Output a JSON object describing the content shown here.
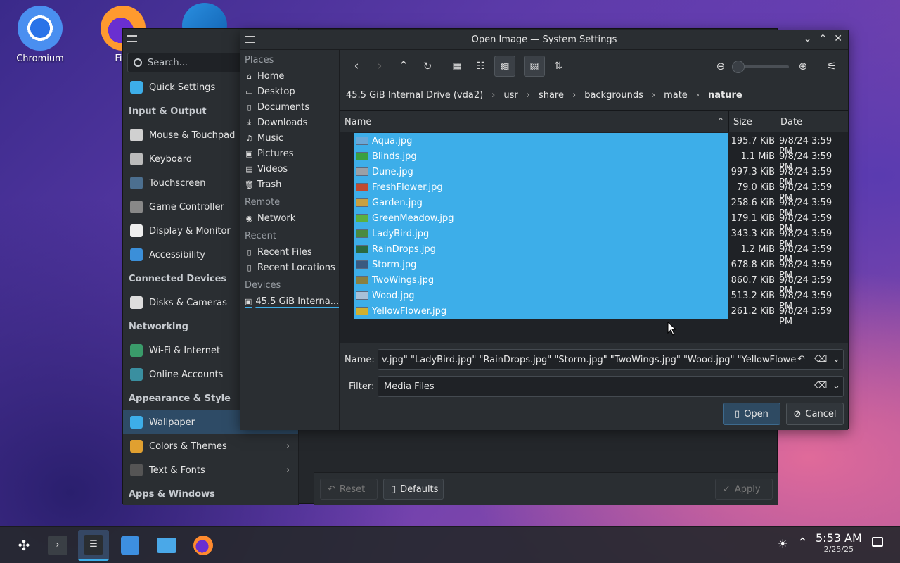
{
  "desktop": {
    "icons": [
      {
        "label": "Chromium",
        "icon": "chromium-icon"
      },
      {
        "label": "Fire",
        "icon": "firefox-icon"
      },
      {
        "label": "",
        "icon": "vscode-icon"
      }
    ]
  },
  "settings": {
    "search_placeholder": "Search...",
    "sidebar": [
      {
        "type": "item",
        "label": "Quick Settings",
        "icon": "quick-settings-icon",
        "color": "#3daee9"
      },
      {
        "type": "section",
        "label": "Input & Output"
      },
      {
        "type": "item",
        "label": "Mouse & Touchpad",
        "icon": "mouse-icon",
        "color": "#d0d0d0"
      },
      {
        "type": "item",
        "label": "Keyboard",
        "icon": "keyboard-icon",
        "color": "#bbbbbb"
      },
      {
        "type": "item",
        "label": "Touchscreen",
        "icon": "touchscreen-icon",
        "color": "#4c6f8f"
      },
      {
        "type": "item",
        "label": "Game Controller",
        "icon": "gamepad-icon",
        "color": "#888888"
      },
      {
        "type": "item",
        "label": "Display & Monitor",
        "icon": "display-icon",
        "color": "#eeeeee"
      },
      {
        "type": "item",
        "label": "Accessibility",
        "icon": "accessibility-icon",
        "color": "#3b8fd9"
      },
      {
        "type": "section",
        "label": "Connected Devices"
      },
      {
        "type": "item",
        "label": "Disks & Cameras",
        "icon": "disks-icon",
        "color": "#dddddd"
      },
      {
        "type": "section",
        "label": "Networking"
      },
      {
        "type": "item",
        "label": "Wi-Fi & Internet",
        "icon": "globe-icon",
        "color": "#3a9b6a"
      },
      {
        "type": "item",
        "label": "Online Accounts",
        "icon": "online-accounts-icon",
        "color": "#3a8fa0"
      },
      {
        "type": "section",
        "label": "Appearance & Style"
      },
      {
        "type": "item",
        "label": "Wallpaper",
        "icon": "wallpaper-icon",
        "color": "#3daee9",
        "active": true
      },
      {
        "type": "item",
        "label": "Colors & Themes",
        "icon": "colors-icon",
        "color": "#e0a030",
        "chevron": true
      },
      {
        "type": "item",
        "label": "Text & Fonts",
        "icon": "fonts-icon",
        "color": "#555555",
        "chevron": true
      },
      {
        "type": "section",
        "label": "Apps & Windows"
      }
    ],
    "buttons": {
      "reset": "Reset",
      "defaults": "Defaults",
      "apply": "Apply"
    }
  },
  "dialog": {
    "title": "Open Image — System Settings",
    "places": [
      {
        "type": "section",
        "label": "Places"
      },
      {
        "type": "item",
        "label": "Home",
        "icon": "home-icon",
        "glyph": "⌂"
      },
      {
        "type": "item",
        "label": "Desktop",
        "icon": "desktop-icon",
        "glyph": "▭"
      },
      {
        "type": "item",
        "label": "Documents",
        "icon": "documents-icon",
        "glyph": "▯"
      },
      {
        "type": "item",
        "label": "Downloads",
        "icon": "downloads-icon",
        "glyph": "⤓"
      },
      {
        "type": "item",
        "label": "Music",
        "icon": "music-icon",
        "glyph": "♫"
      },
      {
        "type": "item",
        "label": "Pictures",
        "icon": "pictures-icon",
        "glyph": "▣"
      },
      {
        "type": "item",
        "label": "Videos",
        "icon": "videos-icon",
        "glyph": "▤"
      },
      {
        "type": "item",
        "label": "Trash",
        "icon": "trash-icon",
        "glyph": "🗑"
      },
      {
        "type": "section",
        "label": "Remote"
      },
      {
        "type": "item",
        "label": "Network",
        "icon": "network-icon",
        "glyph": "◉"
      },
      {
        "type": "section",
        "label": "Recent"
      },
      {
        "type": "item",
        "label": "Recent Files",
        "icon": "recent-files-icon",
        "glyph": "▯"
      },
      {
        "type": "item",
        "label": "Recent Locations",
        "icon": "recent-locations-icon",
        "glyph": "▯"
      },
      {
        "type": "section",
        "label": "Devices"
      },
      {
        "type": "item",
        "label": "45.5 GiB Interna...",
        "icon": "drive-icon",
        "glyph": "▣",
        "device": true
      }
    ],
    "breadcrumb": [
      {
        "label": "45.5 GiB Internal Drive (vda2)"
      },
      {
        "label": "usr"
      },
      {
        "label": "share"
      },
      {
        "label": "backgrounds"
      },
      {
        "label": "mate"
      },
      {
        "label": "nature",
        "current": true
      }
    ],
    "columns": {
      "name": "Name",
      "size": "Size",
      "date": "Date"
    },
    "files": [
      {
        "name": "Aqua.jpg",
        "size": "195.7 KiB",
        "date": "9/8/24 3:59 PM",
        "thumb": "#6aa8d8"
      },
      {
        "name": "Blinds.jpg",
        "size": "1.1 MiB",
        "date": "9/8/24 3:59 PM",
        "thumb": "#3aa040"
      },
      {
        "name": "Dune.jpg",
        "size": "997.3 KiB",
        "date": "9/8/24 3:59 PM",
        "thumb": "#9aa0a6"
      },
      {
        "name": "FreshFlower.jpg",
        "size": "79.0 KiB",
        "date": "9/8/24 3:59 PM",
        "thumb": "#c04a30"
      },
      {
        "name": "Garden.jpg",
        "size": "258.6 KiB",
        "date": "9/8/24 3:59 PM",
        "thumb": "#c8a040"
      },
      {
        "name": "GreenMeadow.jpg",
        "size": "179.1 KiB",
        "date": "9/8/24 3:59 PM",
        "thumb": "#5ab040"
      },
      {
        "name": "LadyBird.jpg",
        "size": "343.3 KiB",
        "date": "9/8/24 3:59 PM",
        "thumb": "#4a8a40"
      },
      {
        "name": "RainDrops.jpg",
        "size": "1.2 MiB",
        "date": "9/8/24 3:59 PM",
        "thumb": "#2a6a40"
      },
      {
        "name": "Storm.jpg",
        "size": "678.8 KiB",
        "date": "9/8/24 3:59 PM",
        "thumb": "#3a5a80"
      },
      {
        "name": "TwoWings.jpg",
        "size": "860.7 KiB",
        "date": "9/8/24 3:59 PM",
        "thumb": "#8a8040"
      },
      {
        "name": "Wood.jpg",
        "size": "513.2 KiB",
        "date": "9/8/24 3:59 PM",
        "thumb": "#a8c0d8"
      },
      {
        "name": "YellowFlower.jpg",
        "size": "261.2 KiB",
        "date": "9/8/24 3:59 PM",
        "thumb": "#d0b030"
      }
    ],
    "name_label": "Name:",
    "name_value": "v.jpg\" \"LadyBird.jpg\" \"RainDrops.jpg\" \"Storm.jpg\" \"TwoWings.jpg\" \"Wood.jpg\" \"YellowFlower.jpg\"",
    "filter_label": "Filter:",
    "filter_value": "Media Files",
    "open_label": "Open",
    "cancel_label": "Cancel"
  },
  "taskbar": {
    "time": "5:53 AM",
    "date": "2/25/25"
  },
  "colors": {
    "accent": "#3daee9",
    "selection": "#3daee9",
    "dialog_bg": "#2a2e32"
  }
}
